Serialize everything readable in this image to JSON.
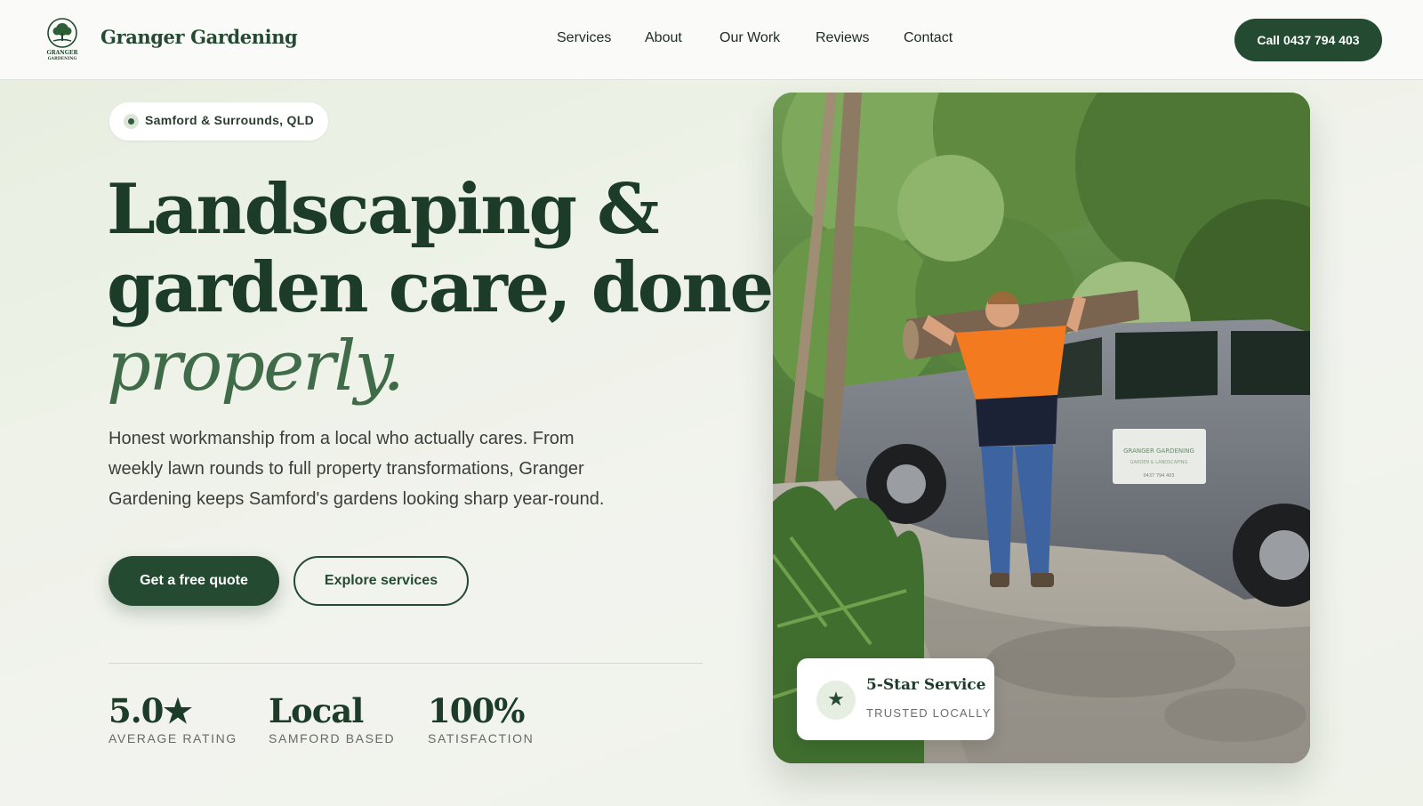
{
  "header": {
    "logo_lines": [
      "GRANGER",
      "GARDENING"
    ],
    "brand": "Granger Gardening",
    "nav": [
      "Services",
      "About",
      "Our Work",
      "Reviews",
      "Contact"
    ],
    "call_label": "Call 0437 794 403"
  },
  "hero": {
    "location": "Samford & Surrounds, QLD",
    "headline_line1": "Landscaping &",
    "headline_line2": "garden care, done",
    "headline_line3": "properly.",
    "subcopy": "Honest workmanship from a local who actually cares. From weekly lawn rounds to full property transformations, Granger Gardening keeps Samford's gardens looking sharp year-round.",
    "primary_cta": "Get a free quote",
    "secondary_cta": "Explore services",
    "stats": [
      {
        "value": "5.0★",
        "label": "AVERAGE RATING"
      },
      {
        "value": "Local",
        "label": "SAMFORD BASED"
      },
      {
        "value": "100%",
        "label": "SATISFACTION"
      }
    ]
  },
  "badge": {
    "icon": "star-icon",
    "title": "5-Star Service",
    "subtitle": "TRUSTED LOCALLY"
  },
  "photo_truck_sign": {
    "name": "GRANGER GARDENING",
    "tagline": "GARDEN & LANDSCAPING",
    "phone": "0437 794 403"
  },
  "colors": {
    "brand_green": "#244a32",
    "accent_green": "#3f6b48",
    "background": "#eef2e8"
  }
}
